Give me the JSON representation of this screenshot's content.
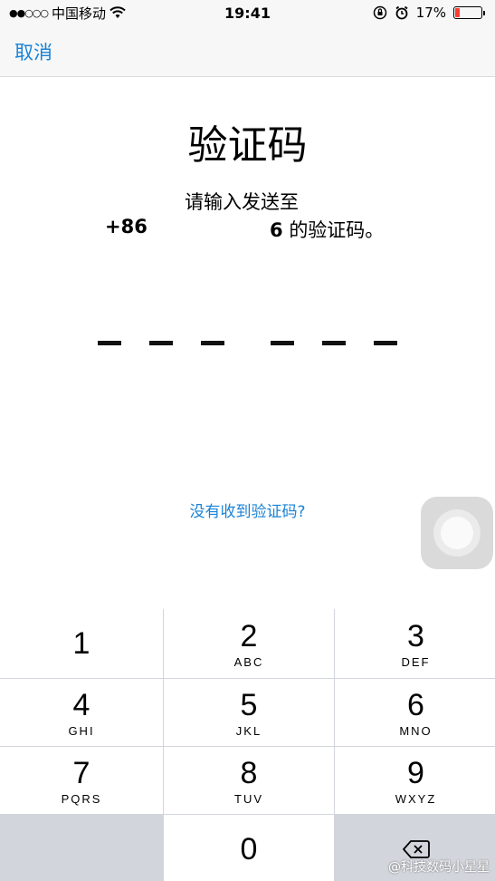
{
  "status_bar": {
    "signal": "●●○○○",
    "carrier": "中国移动",
    "time": "19:41",
    "battery_percent": "17%",
    "battery_level": 0.17
  },
  "nav": {
    "cancel_label": "取消"
  },
  "main": {
    "title": "验证码",
    "instruction": "请输入发送至",
    "phone_prefix": "+86",
    "phone_suffix": "6",
    "phone_tail_text": "的验证码。",
    "code_slots": 6,
    "resend_link": "没有收到验证码?"
  },
  "keypad": {
    "keys": [
      {
        "num": "1",
        "letters": ""
      },
      {
        "num": "2",
        "letters": "ABC"
      },
      {
        "num": "3",
        "letters": "DEF"
      },
      {
        "num": "4",
        "letters": "GHI"
      },
      {
        "num": "5",
        "letters": "JKL"
      },
      {
        "num": "6",
        "letters": "MNO"
      },
      {
        "num": "7",
        "letters": "PQRS"
      },
      {
        "num": "8",
        "letters": "TUV"
      },
      {
        "num": "9",
        "letters": "WXYZ"
      },
      {
        "num": "0",
        "letters": ""
      }
    ]
  },
  "watermark": "@科技数码小星星",
  "colors": {
    "accent": "#1a82d6",
    "battery_low": "#ff3b30",
    "keypad_bg": "#d2d5db"
  }
}
